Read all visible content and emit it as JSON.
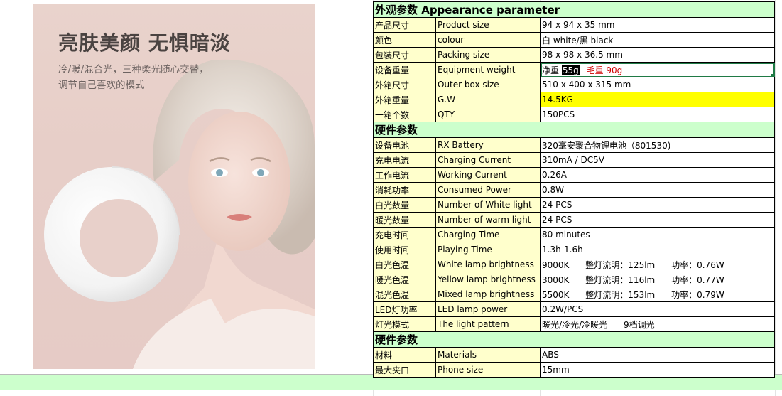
{
  "poster": {
    "headline": "亮肤美颜 无惧暗淡",
    "subtitle_line1": "冷/暖/混合光，三种柔光随心交替，",
    "subtitle_line2": "调节自己喜欢的模式"
  },
  "sections": {
    "appearance": "外观参数  Appearance parameter",
    "hardware": "硬件参数",
    "hardware2": "硬件参数"
  },
  "appearance_rows": [
    {
      "cn": "产品尺寸",
      "en": "Product size",
      "val": "94 x 94 x 35 mm"
    },
    {
      "cn": "颜色",
      "en": "colour",
      "val": "白 white/黑 black"
    },
    {
      "cn": "包装尺寸",
      "en": "Packing size",
      "val": "98 x 98 x 36.5 mm"
    },
    {
      "cn": "设备重量",
      "en": "Equipment weight",
      "net_label": "净重",
      "net_value": "55g",
      "gross": "毛重 90g"
    },
    {
      "cn": "外箱尺寸",
      "en": "Outer box size",
      "val": "510 x 400 x 315  mm"
    },
    {
      "cn": "外箱重量",
      "en": "G.W",
      "val": "14.5KG"
    },
    {
      "cn": "一箱个数",
      "en": "QTY",
      "val": "150PCS"
    }
  ],
  "hardware_rows": [
    {
      "cn": "设备电池",
      "en": "RX Battery",
      "val": "320毫安聚合物锂电池（801530)"
    },
    {
      "cn": "充电电流",
      "en": "Charging Current",
      "val": "310mA / DC5V"
    },
    {
      "cn": "工作电流",
      "en": "Working Current",
      "val": "0.26A"
    },
    {
      "cn": "消耗功率",
      "en": "Consumed Power",
      "val": "0.8W"
    },
    {
      "cn": "白光数量",
      "en": "Number of White light",
      "val": "24 PCS"
    },
    {
      "cn": "暖光数量",
      "en": "Number of warm light",
      "val": "24 PCS"
    },
    {
      "cn": "充电时间",
      "en": "Charging Time",
      "val": "80 minutes"
    },
    {
      "cn": "使用时间",
      "en": "Playing Time",
      "val": "1.3h-1.6h"
    },
    {
      "cn": "白光色温",
      "en": "White lamp brightness",
      "val": "9000K      整灯流明：125lm      功率：0.76W"
    },
    {
      "cn": "暖光色温",
      "en": "Yellow lamp brightness",
      "val": "3000K      整灯流明：116lm      功率：0.77W"
    },
    {
      "cn": "混光色温",
      "en": "Mixed lamp  brightness",
      "val": "5500K      整灯流明：153lm      功率：0.79W"
    },
    {
      "cn": "LED灯功率",
      "en": "LED lamp power",
      "val": "0.2W/PCS"
    },
    {
      "cn": "灯光模式",
      "en": "The light pattern",
      "val": "暖光/冷光/冷暖光      9档调光"
    }
  ],
  "hardware2_rows": [
    {
      "cn": "材料",
      "en": "Materials",
      "val": "ABS"
    },
    {
      "cn": "最大夹口",
      "en": "Phone size",
      "val": "15mm"
    }
  ]
}
